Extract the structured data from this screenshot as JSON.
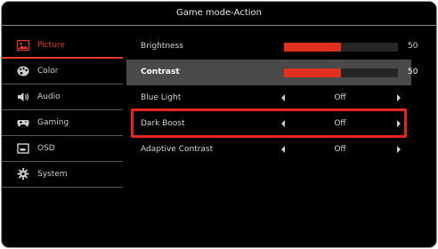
{
  "title": "Game mode-Action",
  "sidebar": {
    "items": [
      {
        "label": "Picture",
        "icon": "picture-icon",
        "active": true
      },
      {
        "label": "Color",
        "icon": "palette-icon",
        "active": false
      },
      {
        "label": "Audio",
        "icon": "speaker-icon",
        "active": false
      },
      {
        "label": "Gaming",
        "icon": "gamepad-icon",
        "active": false
      },
      {
        "label": "OSD",
        "icon": "monitor-icon",
        "active": false
      },
      {
        "label": "System",
        "icon": "gear-icon",
        "active": false
      }
    ]
  },
  "settings": {
    "brightness": {
      "label": "Brightness",
      "value": "50",
      "level": 50
    },
    "contrast": {
      "label": "Contrast",
      "value": "50",
      "level": 50
    },
    "blue_light": {
      "label": "Blue Light",
      "value": "Off"
    },
    "dark_boost": {
      "label": "Dark Boost",
      "value": "Off"
    },
    "adaptive_contrast": {
      "label": "Adaptive Contrast",
      "value": "Off"
    }
  },
  "colors": {
    "accent": "#e8392b",
    "slider_fill": "#e03020",
    "highlight_border": "#e8251b",
    "selected_row_bg": "#4a4a4a"
  }
}
